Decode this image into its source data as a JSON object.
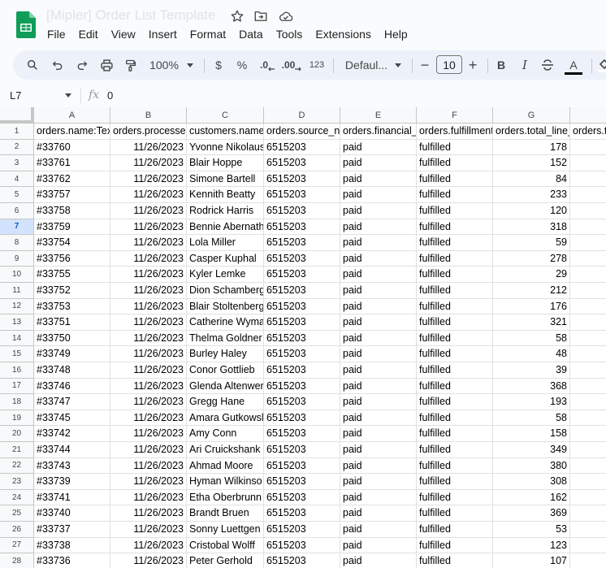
{
  "app": {
    "title": "[Mipler] Order List Template",
    "accent": "#188038",
    "icons": [
      "sheets-logo-icon",
      "star-icon",
      "move-folder-icon",
      "cloud-saved-icon"
    ]
  },
  "menu": [
    "File",
    "Edit",
    "View",
    "Insert",
    "Format",
    "Data",
    "Tools",
    "Extensions",
    "Help"
  ],
  "toolbar": {
    "zoom": "100%",
    "currency": "$",
    "percent": "%",
    "decrease_decimal": ".0",
    "increase_decimal": ".00",
    "number_format": "123",
    "font": "Defaul...",
    "font_size": "10",
    "minus": "−",
    "plus": "+",
    "bold": "B",
    "italic": "I",
    "text_color": "A"
  },
  "formula_bar": {
    "cell_ref": "L7",
    "fx": "fx",
    "value": "0"
  },
  "columns": [
    "A",
    "B",
    "C",
    "D",
    "E",
    "F",
    "G",
    ""
  ],
  "selected_row": 7,
  "header_row": [
    "orders.name:Tex",
    "orders.processe",
    "customers.name",
    "orders.source_n",
    "orders.financial_",
    "orders.fulfillment",
    "orders.total_line_",
    "orders.t"
  ],
  "rows": [
    [
      "#33760",
      "11/26/2023",
      "Yvonne Nikolaus",
      "6515203",
      "paid",
      "fulfilled",
      "178"
    ],
    [
      "#33761",
      "11/26/2023",
      "Blair Hoppe",
      "6515203",
      "paid",
      "fulfilled",
      "152"
    ],
    [
      "#33762",
      "11/26/2023",
      "Simone Bartell",
      "6515203",
      "paid",
      "fulfilled",
      "84"
    ],
    [
      "#33757",
      "11/26/2023",
      "Kennith Beatty",
      "6515203",
      "paid",
      "fulfilled",
      "233"
    ],
    [
      "#33758",
      "11/26/2023",
      "Rodrick Harris",
      "6515203",
      "paid",
      "fulfilled",
      "120"
    ],
    [
      "#33759",
      "11/26/2023",
      "Bennie Abernath",
      "6515203",
      "paid",
      "fulfilled",
      "318"
    ],
    [
      "#33754",
      "11/26/2023",
      "Lola Miller",
      "6515203",
      "paid",
      "fulfilled",
      "59"
    ],
    [
      "#33756",
      "11/26/2023",
      "Casper Kuphal",
      "6515203",
      "paid",
      "fulfilled",
      "278"
    ],
    [
      "#33755",
      "11/26/2023",
      "Kyler Lemke",
      "6515203",
      "paid",
      "fulfilled",
      "29"
    ],
    [
      "#33752",
      "11/26/2023",
      "Dion Schamberg",
      "6515203",
      "paid",
      "fulfilled",
      "212"
    ],
    [
      "#33753",
      "11/26/2023",
      "Blair Stoltenberg",
      "6515203",
      "paid",
      "fulfilled",
      "176"
    ],
    [
      "#33751",
      "11/26/2023",
      "Catherine Wyma",
      "6515203",
      "paid",
      "fulfilled",
      "321"
    ],
    [
      "#33750",
      "11/26/2023",
      "Thelma Goldner",
      "6515203",
      "paid",
      "fulfilled",
      "58"
    ],
    [
      "#33749",
      "11/26/2023",
      "Burley Haley",
      "6515203",
      "paid",
      "fulfilled",
      "48"
    ],
    [
      "#33748",
      "11/26/2023",
      "Conor Gottlieb",
      "6515203",
      "paid",
      "fulfilled",
      "39"
    ],
    [
      "#33746",
      "11/26/2023",
      "Glenda Altenwer",
      "6515203",
      "paid",
      "fulfilled",
      "368"
    ],
    [
      "#33747",
      "11/26/2023",
      "Gregg Hane",
      "6515203",
      "paid",
      "fulfilled",
      "193"
    ],
    [
      "#33745",
      "11/26/2023",
      "Amara Gutkowsl",
      "6515203",
      "paid",
      "fulfilled",
      "58"
    ],
    [
      "#33742",
      "11/26/2023",
      "Amy Conn",
      "6515203",
      "paid",
      "fulfilled",
      "158"
    ],
    [
      "#33744",
      "11/26/2023",
      "Ari Cruickshank",
      "6515203",
      "paid",
      "fulfilled",
      "349"
    ],
    [
      "#33743",
      "11/26/2023",
      "Ahmad Moore",
      "6515203",
      "paid",
      "fulfilled",
      "380"
    ],
    [
      "#33739",
      "11/26/2023",
      "Hyman Wilkinso",
      "6515203",
      "paid",
      "fulfilled",
      "308"
    ],
    [
      "#33741",
      "11/26/2023",
      "Etha Oberbrunn",
      "6515203",
      "paid",
      "fulfilled",
      "162"
    ],
    [
      "#33740",
      "11/26/2023",
      "Brandt Bruen",
      "6515203",
      "paid",
      "fulfilled",
      "369"
    ],
    [
      "#33737",
      "11/26/2023",
      "Sonny Luettgen",
      "6515203",
      "paid",
      "fulfilled",
      "53"
    ],
    [
      "#33738",
      "11/26/2023",
      "Cristobal Wolff",
      "6515203",
      "paid",
      "fulfilled",
      "123"
    ],
    [
      "#33736",
      "11/26/2023",
      "Peter Gerhold",
      "6515203",
      "paid",
      "fulfilled",
      "107"
    ]
  ]
}
